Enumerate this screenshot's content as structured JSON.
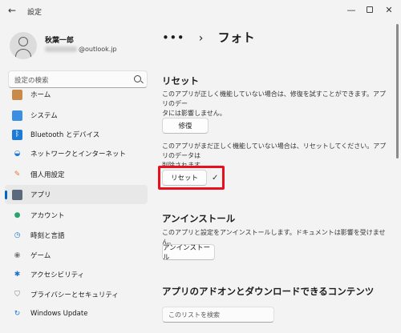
{
  "window": {
    "title": "設定",
    "back_glyph": "←",
    "minimize_glyph": "—",
    "close_glyph": "✕"
  },
  "user": {
    "name": "秋葉一郎",
    "email_visible": "@outlook.jp"
  },
  "search": {
    "placeholder": "設定の検索"
  },
  "nav": [
    {
      "label": "ホーム",
      "icon": "home-icon"
    },
    {
      "label": "システム",
      "icon": "system-icon"
    },
    {
      "label": "Bluetooth とデバイス",
      "icon": "bluetooth-icon"
    },
    {
      "label": "ネットワークとインターネット",
      "icon": "wifi-icon"
    },
    {
      "label": "個人用設定",
      "icon": "brush-icon"
    },
    {
      "label": "アプリ",
      "icon": "apps-icon",
      "active": true
    },
    {
      "label": "アカウント",
      "icon": "account-icon"
    },
    {
      "label": "時刻と言語",
      "icon": "clock-globe-icon"
    },
    {
      "label": "ゲーム",
      "icon": "gamepad-icon"
    },
    {
      "label": "アクセシビリティ",
      "icon": "accessibility-icon"
    },
    {
      "label": "プライバシーとセキュリティ",
      "icon": "shield-icon"
    },
    {
      "label": "Windows Update",
      "icon": "update-icon"
    }
  ],
  "breadcrumb": {
    "dots": "•••",
    "chevron": "›",
    "current": "フォト"
  },
  "reset_section": {
    "title": "リセット",
    "repair_desc_1": "このアプリが正しく機能していない場合は、修復を試すことができます。アプリのデー",
    "repair_desc_2": "タには影響しません。",
    "repair_button": "修復",
    "reset_desc_1": "このアプリがまだ正しく機能していない場合は、リセットしてください。アプリのデータは",
    "reset_desc_2": "削除されます。",
    "reset_button": "リセット",
    "reset_done_glyph": "✓"
  },
  "uninstall_section": {
    "title": "アンインストール",
    "desc": "このアプリと設定をアンインストールします。ドキュメントは影響を受けません。",
    "button": "アンインストール"
  },
  "addons_section": {
    "title": "アプリのアドオンとダウンロードできるコンテンツ",
    "search_placeholder": "このリストを検索"
  },
  "colors": {
    "accent": "#0067c0",
    "highlight": "#e8101f"
  }
}
